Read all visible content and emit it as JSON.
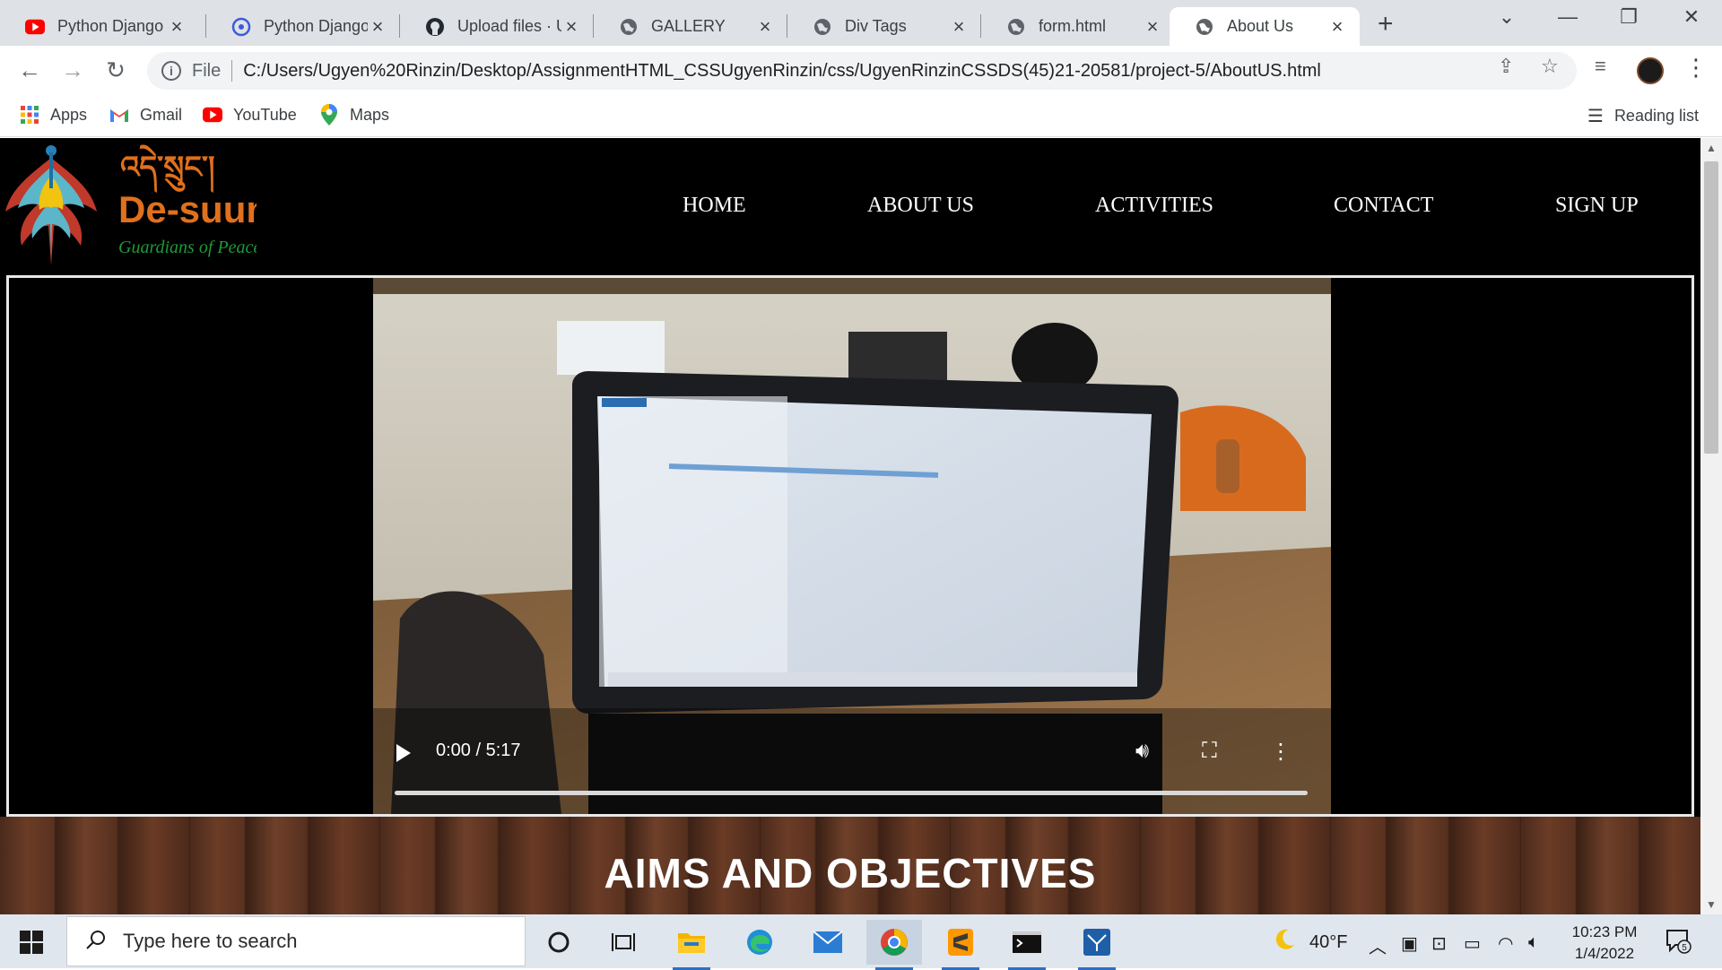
{
  "browser": {
    "tabs": [
      {
        "title": "Python Django",
        "icon": "youtube-icon",
        "active": false
      },
      {
        "title": "Python Django",
        "icon": "app-icon",
        "active": false
      },
      {
        "title": "Upload files · U",
        "icon": "github-icon",
        "active": false
      },
      {
        "title": "GALLERY",
        "icon": "globe-icon",
        "active": false
      },
      {
        "title": "Div Tags",
        "icon": "globe-icon",
        "active": false
      },
      {
        "title": "form.html",
        "icon": "globe-icon",
        "active": false
      },
      {
        "title": "About Us",
        "icon": "globe-icon",
        "active": true
      }
    ],
    "address": {
      "scheme_label": "File",
      "url": "C:/Users/Ugyen%20Rinzin/Desktop/AssignmentHTML_CSSUgyenRinzin/css/UgyenRinzinCSSDS(45)21-20581/project-5/AboutUS.html"
    },
    "bookmarks": [
      {
        "label": "Apps",
        "icon": "apps-grid-icon"
      },
      {
        "label": "Gmail",
        "icon": "gmail-icon"
      },
      {
        "label": "YouTube",
        "icon": "youtube-icon"
      },
      {
        "label": "Maps",
        "icon": "maps-pin-icon"
      }
    ],
    "reading_list_label": "Reading list"
  },
  "site": {
    "logo": {
      "wordmark": "De-suung",
      "tagline": "Guardians of Peace",
      "script_text": "འདེ་སྲུང་།"
    },
    "nav": [
      {
        "label": "HOME"
      },
      {
        "label": "ABOUT US"
      },
      {
        "label": "ACTIVITIES"
      },
      {
        "label": "CONTACT"
      },
      {
        "label": "SIGN UP"
      }
    ],
    "video": {
      "time": "0:00 / 5:17",
      "progress": 0
    },
    "section_heading": "AIMS AND OBJECTIVES"
  },
  "taskbar": {
    "search_placeholder": "Type here to search",
    "weather": "40°F",
    "time": "10:23 PM",
    "date": "1/4/2022",
    "notification_count": "5"
  },
  "colors": {
    "accent_orange": "#e0701c",
    "tagline_green": "#1f9a3a",
    "page_bg": "#000000"
  }
}
